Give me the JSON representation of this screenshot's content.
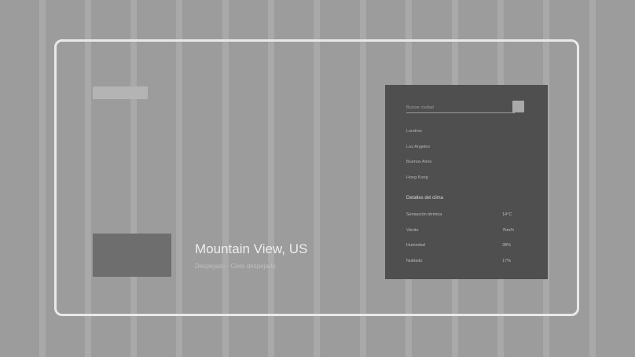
{
  "hero": {
    "location": "Mountain View, US",
    "condition": "Despejado - Cielo despejado"
  },
  "search": {
    "placeholder": "Buscar ciudad"
  },
  "cities": [
    "Londres",
    "Los Angeles",
    "Buenos Aires",
    "Hong Kong"
  ],
  "details": {
    "heading": "Detalles del clima",
    "rows": [
      {
        "label": "Sensación térmica",
        "value": "14°C"
      },
      {
        "label": "Viento",
        "value": "7km/h"
      },
      {
        "label": "Humedad",
        "value": "38%"
      },
      {
        "label": "Nublado",
        "value": "17%"
      }
    ]
  }
}
